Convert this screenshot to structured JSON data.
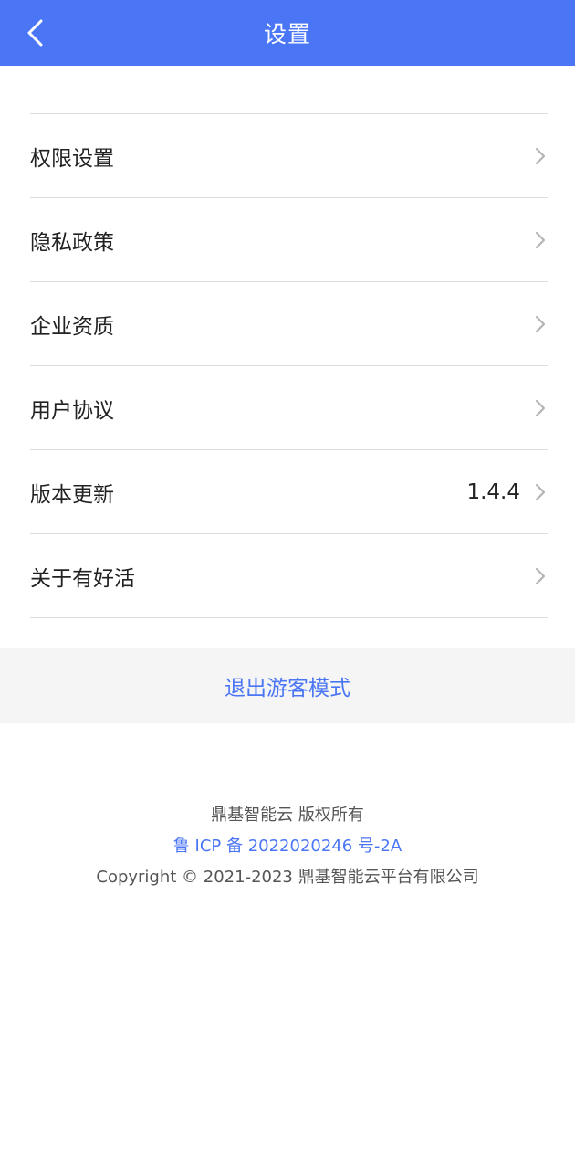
{
  "header": {
    "title": "设置",
    "back_icon": "chevron-left-icon"
  },
  "menu": {
    "items": [
      {
        "label": "权限设置",
        "value": ""
      },
      {
        "label": "隐私政策",
        "value": ""
      },
      {
        "label": "企业资质",
        "value": ""
      },
      {
        "label": "用户协议",
        "value": ""
      },
      {
        "label": "版本更新",
        "value": "1.4.4"
      },
      {
        "label": "关于有好活",
        "value": ""
      }
    ]
  },
  "logout": {
    "label": "退出游客模式"
  },
  "footer": {
    "copyright_owner": "鼎基智能云 版权所有",
    "icp": "鲁 ICP 备 2022020246 号-2A",
    "copyright": "Copyright © 2021-2023 鼎基智能云平台有限公司"
  },
  "colors": {
    "accent": "#4a76f5",
    "divider": "#dcdcdc",
    "logout_bg": "#f5f5f5"
  }
}
